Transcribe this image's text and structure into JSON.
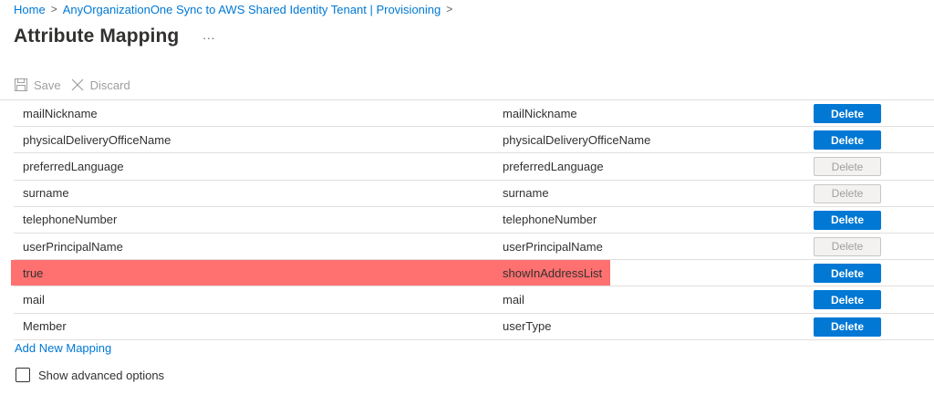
{
  "breadcrumb": {
    "home": "Home",
    "parent": "AnyOrganizationOne Sync to AWS Shared Identity Tenant | Provisioning"
  },
  "page": {
    "title": "Attribute Mapping",
    "more_glyph": "..."
  },
  "toolbar": {
    "save_label": "Save",
    "discard_label": "Discard",
    "save_icon": "save-icon",
    "discard_icon": "close-icon"
  },
  "mappings": [
    {
      "source": "mailNickname",
      "target": "mailNickname",
      "delete_label": "Delete",
      "delete_enabled": true
    },
    {
      "source": "physicalDeliveryOfficeName",
      "target": "physicalDeliveryOfficeName",
      "delete_label": "Delete",
      "delete_enabled": true
    },
    {
      "source": "preferredLanguage",
      "target": "preferredLanguage",
      "delete_label": "Delete",
      "delete_enabled": false
    },
    {
      "source": "surname",
      "target": "surname",
      "delete_label": "Delete",
      "delete_enabled": false
    },
    {
      "source": "telephoneNumber",
      "target": "telephoneNumber",
      "delete_label": "Delete",
      "delete_enabled": true
    },
    {
      "source": "userPrincipalName",
      "target": "userPrincipalName",
      "delete_label": "Delete",
      "delete_enabled": false
    },
    {
      "source": "true",
      "target": "showInAddressList",
      "delete_label": "Delete",
      "delete_enabled": true,
      "highlighted": true
    },
    {
      "source": "mail",
      "target": "mail",
      "delete_label": "Delete",
      "delete_enabled": true
    },
    {
      "source": "Member",
      "target": "userType",
      "delete_label": "Delete",
      "delete_enabled": true
    }
  ],
  "add_mapping_label": "Add New Mapping",
  "advanced_options": {
    "label": "Show advanced options",
    "checked": false
  },
  "colors": {
    "accent": "#0078d4",
    "highlight": "#ff7070",
    "disabled_text": "#a19f9d"
  }
}
